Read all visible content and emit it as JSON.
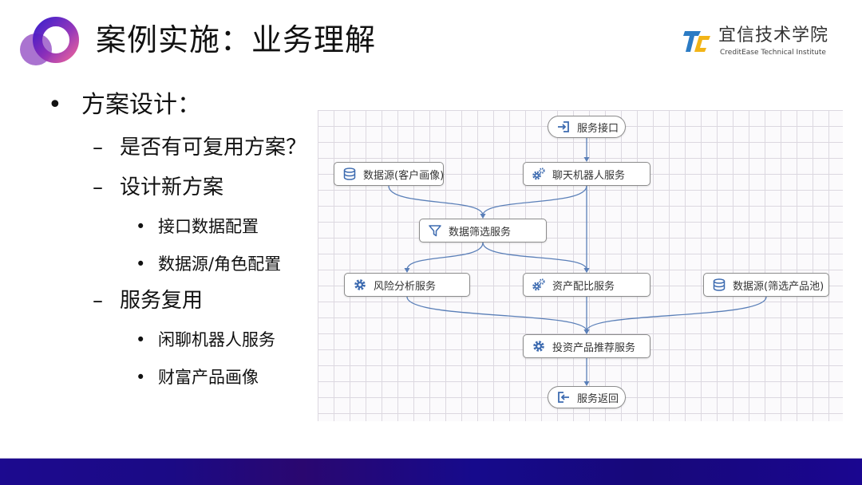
{
  "slide": {
    "title": "案例实施：业务理解",
    "logo_icon": "overlapping-rings-logo",
    "brand": {
      "name_cn": "宜信技术学院",
      "name_en": "CreditEase Technical Institute",
      "mark_icon": "tc-logo-mark",
      "colors": {
        "blue": "#2b7bc4",
        "yellow": "#f2b417"
      }
    },
    "footer_color": "#1a0a8c"
  },
  "bullets": [
    {
      "level": 1,
      "marker": "•",
      "text": "方案设计："
    },
    {
      "level": 2,
      "marker": "–",
      "text": "是否有可复用方案？"
    },
    {
      "level": 2,
      "marker": "–",
      "text": "设计新方案"
    },
    {
      "level": 3,
      "marker": "•",
      "text": "接口数据配置"
    },
    {
      "level": 3,
      "marker": "•",
      "text": "数据源/角色配置"
    },
    {
      "level": 2,
      "marker": "–",
      "text": "服务复用"
    },
    {
      "level": 3,
      "marker": "•",
      "text": "闲聊机器人服务"
    },
    {
      "level": 3,
      "marker": "•",
      "text": "财富产品画像"
    }
  ],
  "diagram": {
    "edge_color": "#5a7fb8",
    "icon_color": "#3d6bb0",
    "nodes": [
      {
        "id": "api_in",
        "label": "服务接口",
        "icon": "login-icon",
        "shape": "pill"
      },
      {
        "id": "ds_client",
        "label": "数据源(客户画像)",
        "icon": "database-icon",
        "shape": "box"
      },
      {
        "id": "chatbot",
        "label": "聊天机器人服务",
        "icon": "gears-icon",
        "shape": "box"
      },
      {
        "id": "filter",
        "label": "数据筛选服务",
        "icon": "filter-icon",
        "shape": "box"
      },
      {
        "id": "risk",
        "label": "风险分析服务",
        "icon": "gear-icon",
        "shape": "box"
      },
      {
        "id": "alloc",
        "label": "资产配比服务",
        "icon": "gears-icon",
        "shape": "box"
      },
      {
        "id": "ds_pool",
        "label": "数据源(筛选产品池)",
        "icon": "database-icon",
        "shape": "box"
      },
      {
        "id": "recommend",
        "label": "投资产品推荐服务",
        "icon": "gear-icon",
        "shape": "box"
      },
      {
        "id": "api_out",
        "label": "服务返回",
        "icon": "logout-icon",
        "shape": "pill"
      }
    ],
    "edges": [
      {
        "from": "api_in",
        "to": "chatbot"
      },
      {
        "from": "ds_client",
        "to": "filter"
      },
      {
        "from": "chatbot",
        "to": "filter"
      },
      {
        "from": "chatbot",
        "to": "alloc"
      },
      {
        "from": "filter",
        "to": "risk"
      },
      {
        "from": "filter",
        "to": "alloc"
      },
      {
        "from": "risk",
        "to": "recommend"
      },
      {
        "from": "alloc",
        "to": "recommend"
      },
      {
        "from": "ds_pool",
        "to": "recommend"
      },
      {
        "from": "recommend",
        "to": "api_out"
      }
    ]
  }
}
